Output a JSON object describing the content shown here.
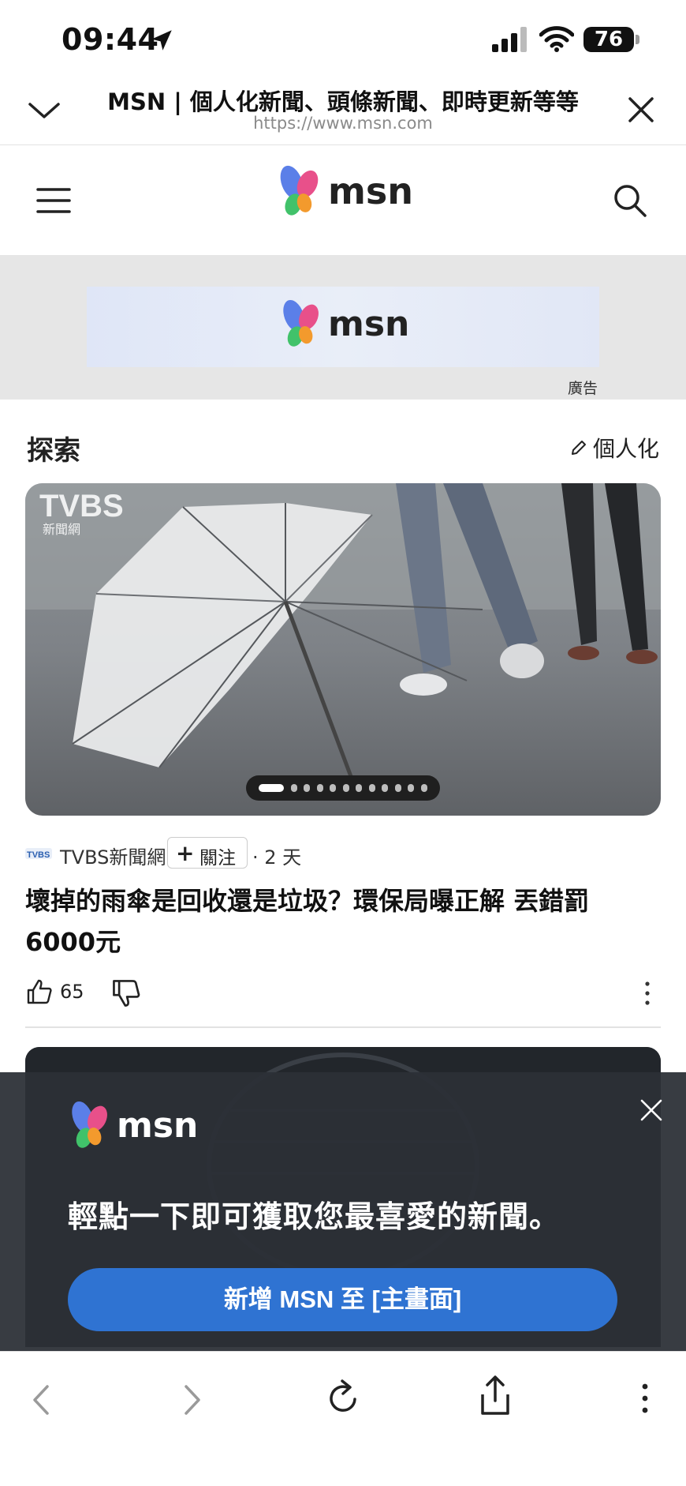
{
  "status_bar": {
    "time": "09:44",
    "battery": "76"
  },
  "browser": {
    "title": "MSN | 個人化新聞、頭條新聞、即時更新等等",
    "url": "https://www.msn.com"
  },
  "msn_header": {
    "logo_text": "msn"
  },
  "ad": {
    "logo_text": "msn",
    "label": "廣告"
  },
  "explore": {
    "title": "探索",
    "personalize_label": "個人化"
  },
  "article": {
    "source_name": "TVBS新聞網",
    "watermark": "TVBS 新聞網",
    "follow_label": "關注",
    "time_ago": "· 2 天",
    "headline": "壞掉的雨傘是回收還是垃圾？環保局曝正解 丟錯罰6000元",
    "likes": "65",
    "carousel": {
      "count": 12,
      "active": 0
    }
  },
  "promo": {
    "logo_text": "msn",
    "message": "輕點一下即可獲取您最喜愛的新聞。",
    "cta_label": "新增 MSN 至 [主畫面]"
  },
  "colors": {
    "cta_blue": "#2f73d2",
    "promo_bg": "#2c3036"
  }
}
